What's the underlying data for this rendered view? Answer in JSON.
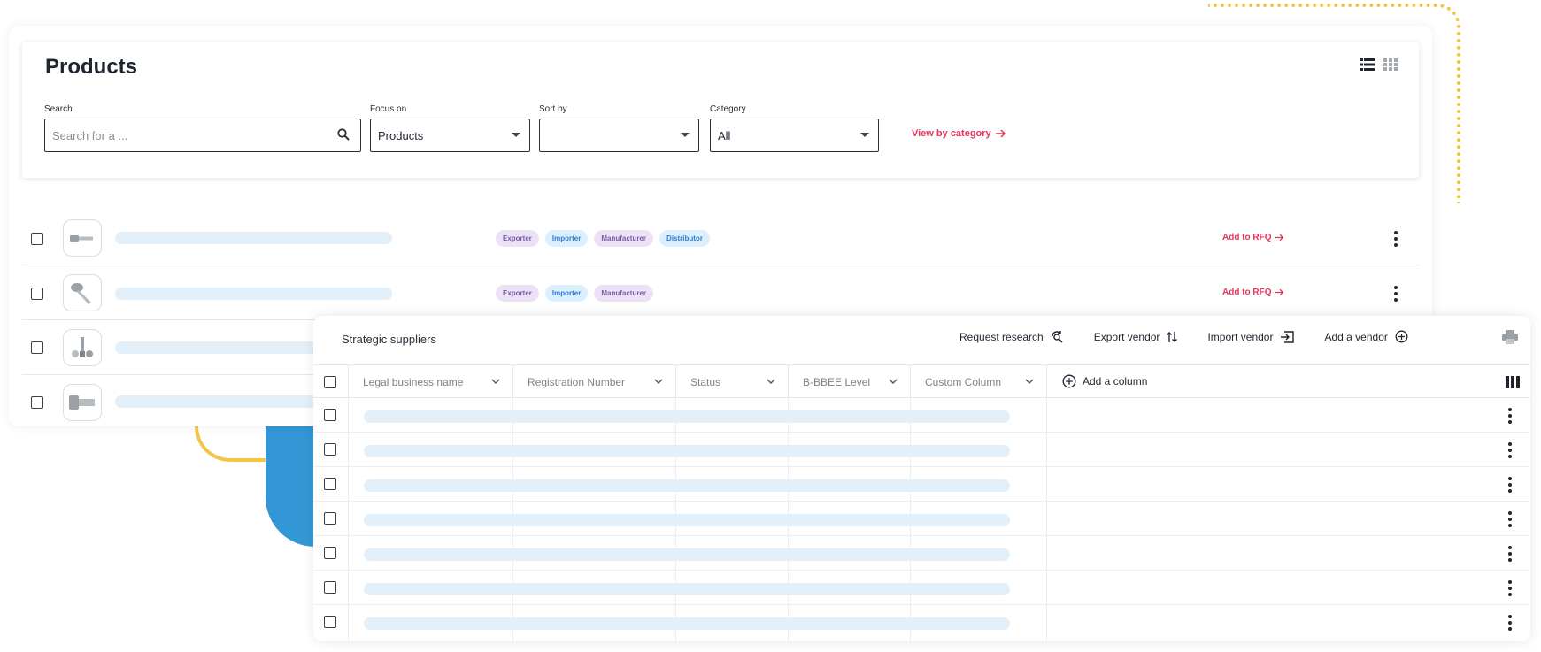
{
  "products": {
    "title": "Products",
    "filters": {
      "search_label": "Search",
      "search_placeholder": "Search for a ...",
      "focus_label": "Focus on",
      "focus_value": "Products",
      "sort_label": "Sort by",
      "sort_value": "",
      "category_label": "Category",
      "category_value": "All",
      "view_by_category": "View by category"
    },
    "rows": [
      {
        "tags": [
          {
            "label": "Exporter",
            "color": "purple"
          },
          {
            "label": "Importer",
            "color": "blue"
          },
          {
            "label": "Manufacturer",
            "color": "purple"
          },
          {
            "label": "Distributor",
            "color": "blue"
          }
        ],
        "action": "Add to RFQ"
      },
      {
        "tags": [
          {
            "label": "Exporter",
            "color": "purple"
          },
          {
            "label": "Importer",
            "color": "blue"
          },
          {
            "label": "Manufacturer",
            "color": "purple"
          }
        ],
        "action": "Add to RFQ"
      },
      {
        "tags": [],
        "action": ""
      },
      {
        "tags": [],
        "action": ""
      }
    ]
  },
  "suppliers": {
    "title": "Strategic suppliers",
    "actions": {
      "request_research": "Request research",
      "export_vendor": "Export vendor",
      "import_vendor": "Import vendor",
      "add_vendor": "Add a vendor"
    },
    "columns": [
      "Legal business name",
      "Registration Number",
      "Status",
      "B-BBEE Level",
      "Custom Column"
    ],
    "add_column": "Add a column"
  },
  "colors": {
    "accent": "#e8355a",
    "tag_purple_bg": "#ece2f6",
    "tag_blue_bg": "#dcefff",
    "skeleton": "#e3eff9",
    "deco_blue": "#3497d5",
    "deco_yellow": "#f3c64a"
  },
  "icons": [
    "list-view-icon",
    "grid-view-icon",
    "search-icon",
    "arrow-right-icon",
    "more-vertical-icon",
    "refresh-search-icon",
    "sort-arrows-icon",
    "import-icon",
    "plus-circle-icon",
    "print-icon",
    "columns-icon",
    "chevron-down-icon"
  ]
}
